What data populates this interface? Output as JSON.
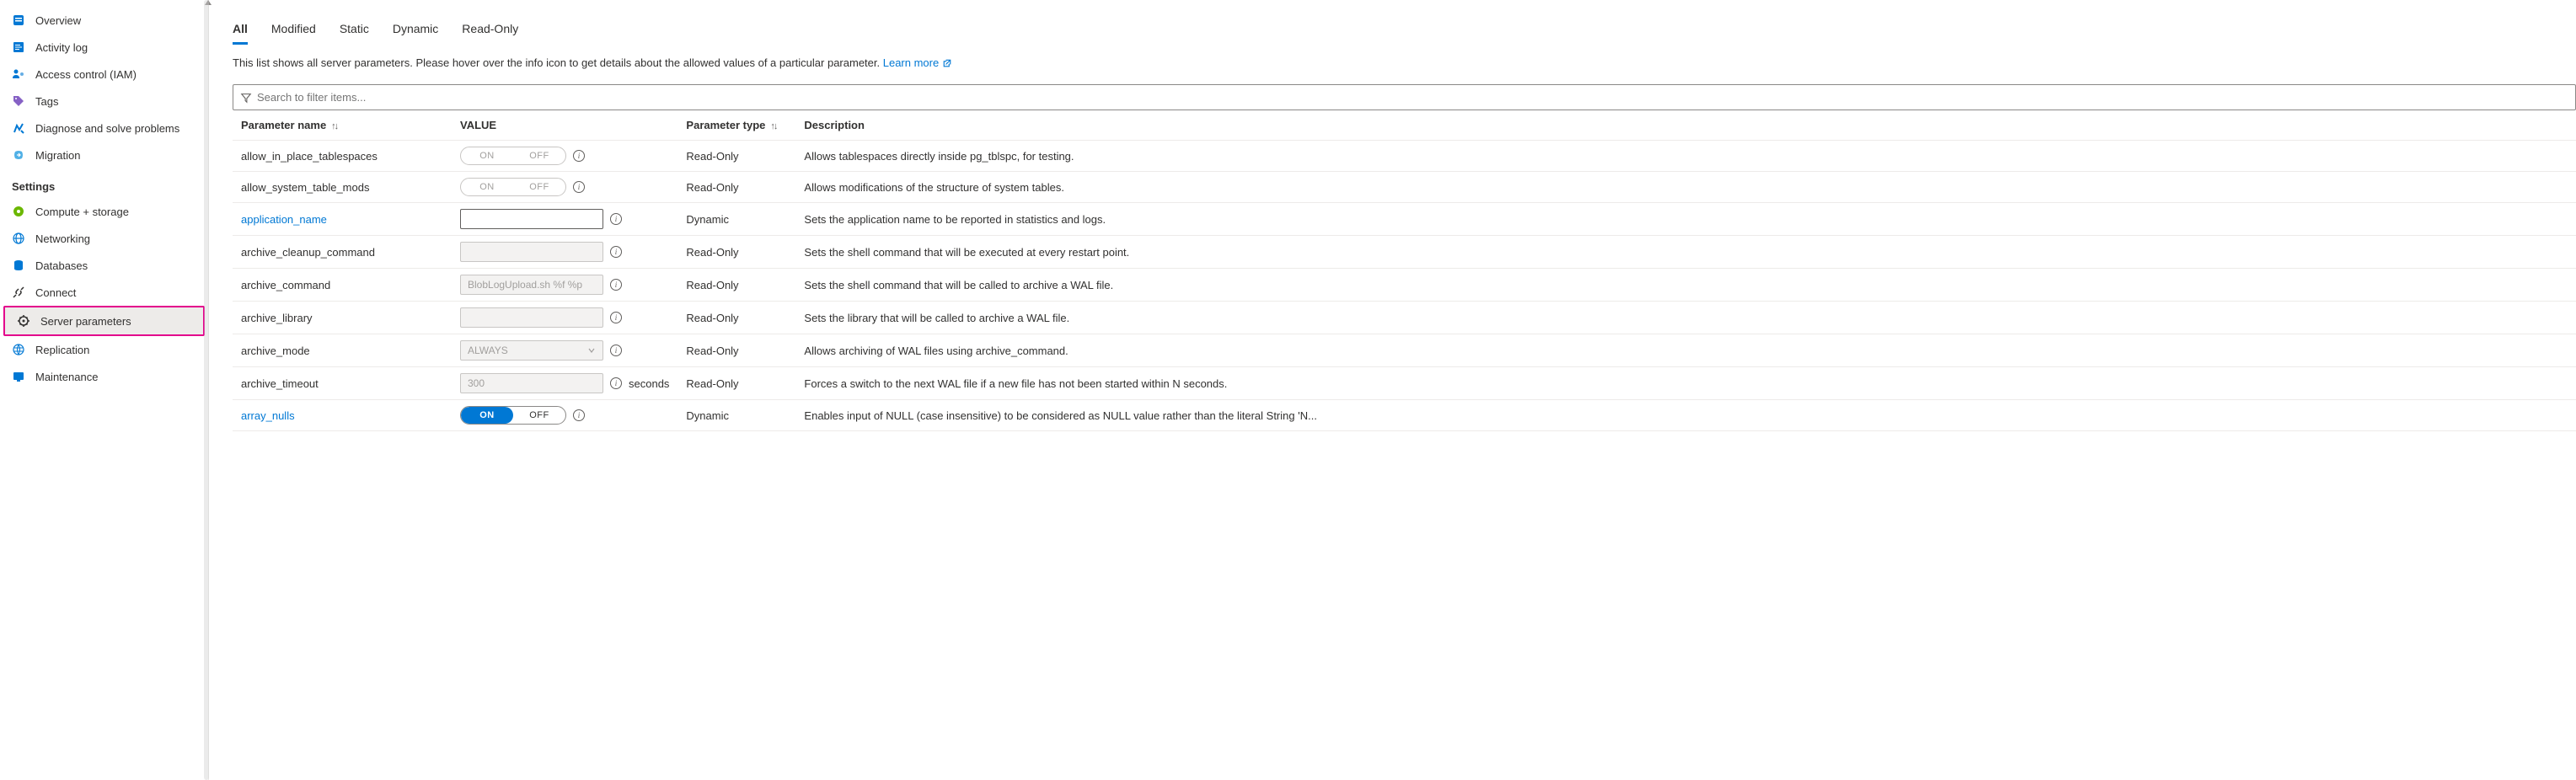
{
  "sidebar": {
    "top_items": [
      {
        "label": "Overview"
      },
      {
        "label": "Activity log"
      },
      {
        "label": "Access control (IAM)"
      },
      {
        "label": "Tags"
      },
      {
        "label": "Diagnose and solve problems"
      },
      {
        "label": "Migration"
      }
    ],
    "section_label": "Settings",
    "settings_items": [
      {
        "label": "Compute + storage"
      },
      {
        "label": "Networking"
      },
      {
        "label": "Databases"
      },
      {
        "label": "Connect"
      },
      {
        "label": "Server parameters"
      },
      {
        "label": "Replication"
      },
      {
        "label": "Maintenance"
      }
    ]
  },
  "tabs": [
    "All",
    "Modified",
    "Static",
    "Dynamic",
    "Read-Only"
  ],
  "intro_text": "This list shows all server parameters. Please hover over the info icon to get details about the allowed values of a particular parameter. ",
  "learn_more": "Learn more",
  "search_placeholder": "Search to filter items...",
  "columns": {
    "name": "Parameter name",
    "value": "VALUE",
    "type": "Parameter type",
    "desc": "Description"
  },
  "rows": [
    {
      "name": "allow_in_place_tablespaces",
      "link": false,
      "control": "toggle-disabled",
      "val": "",
      "type": "Read-Only",
      "desc": "Allows tablespaces directly inside pg_tblspc, for testing."
    },
    {
      "name": "allow_system_table_mods",
      "link": false,
      "control": "toggle-disabled",
      "val": "",
      "type": "Read-Only",
      "desc": "Allows modifications of the structure of system tables."
    },
    {
      "name": "application_name",
      "link": true,
      "control": "text",
      "val": "",
      "type": "Dynamic",
      "desc": "Sets the application name to be reported in statistics and logs."
    },
    {
      "name": "archive_cleanup_command",
      "link": false,
      "control": "text-disabled",
      "val": "",
      "type": "Read-Only",
      "desc": "Sets the shell command that will be executed at every restart point."
    },
    {
      "name": "archive_command",
      "link": false,
      "control": "text-disabled",
      "val": "BlobLogUpload.sh %f %p",
      "type": "Read-Only",
      "desc": "Sets the shell command that will be called to archive a WAL file."
    },
    {
      "name": "archive_library",
      "link": false,
      "control": "text-disabled",
      "val": "",
      "type": "Read-Only",
      "desc": "Sets the library that will be called to archive a WAL file."
    },
    {
      "name": "archive_mode",
      "link": false,
      "control": "select-disabled",
      "val": "ALWAYS",
      "type": "Read-Only",
      "desc": "Allows archiving of WAL files using archive_command."
    },
    {
      "name": "archive_timeout",
      "link": false,
      "control": "text-disabled",
      "val": "300",
      "suffix": "seconds",
      "type": "Read-Only",
      "desc": "Forces a switch to the next WAL file if a new file has not been started within N seconds."
    },
    {
      "name": "array_nulls",
      "link": true,
      "control": "toggle-on",
      "val": "",
      "type": "Dynamic",
      "desc": "Enables input of NULL (case insensitive) to be considered as NULL value rather than the literal String 'N..."
    }
  ]
}
